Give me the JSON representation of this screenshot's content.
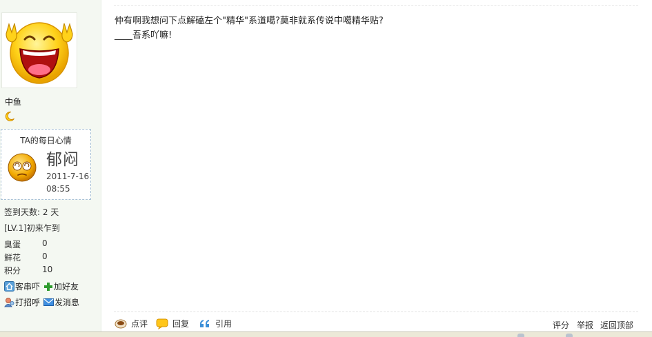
{
  "user": {
    "name": "中鱼"
  },
  "mood": {
    "title": "TA的每日心情",
    "word": "郁闷",
    "date": "2011-7-16",
    "time": "08:55"
  },
  "stats": {
    "signin": "签到天数: 2 天",
    "level": "[LV.1]初来乍到",
    "rows": [
      {
        "label": "臭蛋",
        "value": "0"
      },
      {
        "label": "鲜花",
        "value": "0"
      },
      {
        "label": "积分",
        "value": "10"
      }
    ]
  },
  "links": {
    "home": "客串吓",
    "add_friend": "加好友",
    "greet": "打招呼",
    "message": "发消息"
  },
  "post": {
    "line1": "仲有啊我想问下点解磕左个\"精华\"系道噶?莫非就系传说中噶精华贴?",
    "line2": "____吾系吖嘛!"
  },
  "actions": {
    "comment": "点评",
    "reply": "回复",
    "quote": "引用",
    "rate": "评分",
    "report": "举报",
    "top": "返回顶部"
  },
  "colors": {
    "sidebar_bg": "#f4f8f2",
    "mood_border": "#a9c2d6",
    "accent_green": "#2e9b2e"
  }
}
